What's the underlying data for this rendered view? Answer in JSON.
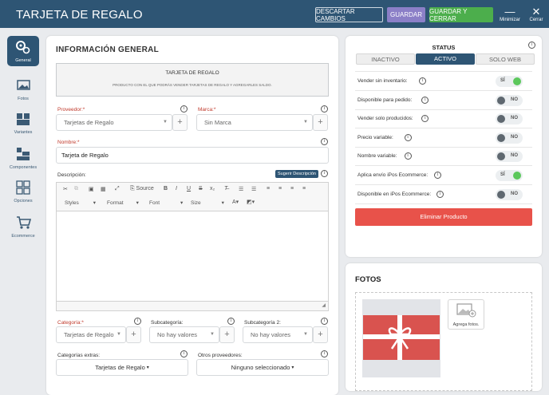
{
  "header": {
    "title": "TARJETA DE REGALO",
    "discard": "DESCARTAR CAMBIOS",
    "save": "GUARDAR",
    "save_close": "GUARDAR Y CERRAR",
    "minimize": "Minimizar",
    "close": "Cerrar"
  },
  "sidebar": [
    {
      "label": "General",
      "icon": "gears-icon"
    },
    {
      "label": "Fotos",
      "icon": "photo-icon"
    },
    {
      "label": "Variantes",
      "icon": "boxes-icon"
    },
    {
      "label": "Componentes",
      "icon": "components-icon"
    },
    {
      "label": "Opciones",
      "icon": "grid-icon"
    },
    {
      "label": "Ecommerce",
      "icon": "cart-icon"
    }
  ],
  "main": {
    "title": "INFORMACIÓN GENERAL",
    "type_box": {
      "title": "TARJETA DE REGALO",
      "desc": "PRODUCTO CON EL QUE PODRÁS VENDER TARJETAS DE REGALO Y AGREGARLES SALDO."
    },
    "provider_label": "Proveedor:",
    "provider_value": "Tarjetas de Regalo",
    "brand_label": "Marca:",
    "brand_value": "Sin Marca",
    "name_label": "Nombre:",
    "name_value": "Tarjeta de Regalo",
    "desc_label": "Descripción:",
    "suggest": "Sugerir Descripción",
    "editor": {
      "source": "Source",
      "styles": "Styles",
      "format": "Format",
      "font": "Font",
      "size": "Size"
    },
    "category_label": "Categoría:",
    "category_value": "Tarjetas de Regalo",
    "subcat_label": "Subcategoría:",
    "subcat_value": "No hay valores",
    "subcat2_label": "Subcategoría 2:",
    "subcat2_value": "No hay valores",
    "extra_label": "Categorías extras:",
    "extra_value": "Tarjetas de Regalo",
    "other_label": "Otros proveedores:",
    "other_value": "Ninguno seleccionado",
    "asterisk": "*"
  },
  "status": {
    "title": "STATUS",
    "tabs": [
      "INACTIVO",
      "ACTIVO",
      "SOLO WEB"
    ],
    "active_tab": 1,
    "delete": "Eliminar Producto",
    "rows": [
      {
        "label": "Vender sin inventario:",
        "value": "SÍ",
        "on": true
      },
      {
        "label": "Disponible para pedido:",
        "value": "NO",
        "on": false
      },
      {
        "label": "Vender solo producidos:",
        "value": "NO",
        "on": false
      },
      {
        "label": "Precio variable:",
        "value": "NO",
        "on": false
      },
      {
        "label": "Nombre variable:",
        "value": "NO",
        "on": false
      },
      {
        "label": "Aplica envío iPos Ecommerce:",
        "value": "SÍ",
        "on": true
      },
      {
        "label": "Disponible en iPos Ecommerce:",
        "value": "NO",
        "on": false
      }
    ]
  },
  "fotos": {
    "title": "FOTOS",
    "add": "Agrega fotos."
  },
  "colors": {
    "primary": "#2e5574",
    "purple": "#8b7fc7",
    "green": "#4cae4c",
    "danger": "#e8524a",
    "toggle_on": "#5cc85c",
    "toggle_off": "#5f6870"
  }
}
